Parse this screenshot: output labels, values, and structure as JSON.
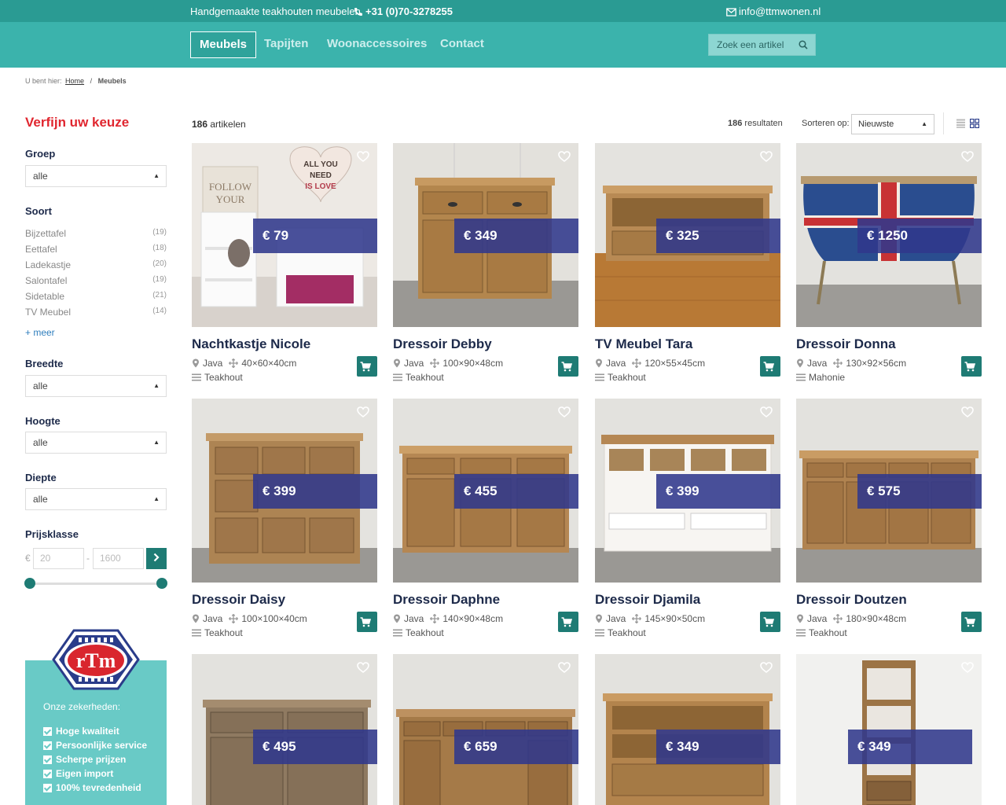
{
  "topbar": {
    "tagline": "Handgemaakte teakhouten meubelen",
    "phone": "+31 (0)70-3278255",
    "email": "info@ttmwonen.nl"
  },
  "nav": {
    "items": [
      "Meubels",
      "Tapijten",
      "Woonaccessoires",
      "Contact"
    ],
    "active": "Meubels",
    "search_placeholder": "Zoek een artikel"
  },
  "breadcrumb": {
    "prefix": "U bent hier:",
    "home": "Home",
    "current": "Meubels"
  },
  "sidebar": {
    "title": "Verfijn uw keuze",
    "groep": {
      "label": "Groep",
      "value": "alle"
    },
    "soort": {
      "label": "Soort",
      "items": [
        {
          "name": "Bijzettafel",
          "count": "(19)"
        },
        {
          "name": "Eettafel",
          "count": "(18)"
        },
        {
          "name": "Ladekastje",
          "count": "(20)"
        },
        {
          "name": "Salontafel",
          "count": "(19)"
        },
        {
          "name": "Sidetable",
          "count": "(21)"
        },
        {
          "name": "TV Meubel",
          "count": "(14)"
        }
      ],
      "more": "+ meer"
    },
    "breedte": {
      "label": "Breedte",
      "value": "alle"
    },
    "hoogte": {
      "label": "Hoogte",
      "value": "alle"
    },
    "diepte": {
      "label": "Diepte",
      "value": "alle"
    },
    "prijsklasse": {
      "label": "Prijsklasse",
      "currency": "€",
      "min_placeholder": "20",
      "max_placeholder": "1600",
      "separator": "-"
    },
    "guarantees": {
      "title": "Onze zekerheden:",
      "items": [
        "Hoge kwaliteit",
        "Persoonlijke service",
        "Scherpe prijzen",
        "Eigen import",
        "100% tevredenheid"
      ]
    }
  },
  "results": {
    "articles_number": "186",
    "articles_label": "artikelen",
    "results_number": "186",
    "results_label": "resultaten",
    "sort_label": "Sorteren op:",
    "sort_value": "Nieuwste"
  },
  "products": [
    {
      "title": "Nachtkastje Nicole",
      "price": "€ 79",
      "origin": "Java",
      "size": "40×60×40cm",
      "material": "Teakhout"
    },
    {
      "title": "Dressoir Debby",
      "price": "€ 349",
      "origin": "Java",
      "size": "100×90×48cm",
      "material": "Teakhout"
    },
    {
      "title": "TV Meubel Tara",
      "price": "€ 325",
      "origin": "Java",
      "size": "120×55×45cm",
      "material": "Teakhout"
    },
    {
      "title": "Dressoir Donna",
      "price": "€ 1250",
      "origin": "Java",
      "size": "130×92×56cm",
      "material": "Mahonie"
    },
    {
      "title": "Dressoir Daisy",
      "price": "€ 399",
      "origin": "Java",
      "size": "100×100×40cm",
      "material": "Teakhout"
    },
    {
      "title": "Dressoir Daphne",
      "price": "€ 455",
      "origin": "Java",
      "size": "140×90×48cm",
      "material": "Teakhout"
    },
    {
      "title": "Dressoir Djamila",
      "price": "€ 399",
      "origin": "Java",
      "size": "145×90×50cm",
      "material": "Teakhout"
    },
    {
      "title": "Dressoir Doutzen",
      "price": "€ 575",
      "origin": "Java",
      "size": "180×90×48cm",
      "material": "Teakhout"
    },
    {
      "price": "€ 495"
    },
    {
      "price": "€ 659"
    },
    {
      "price": "€ 349"
    },
    {
      "price": "€ 349"
    }
  ],
  "colors": {
    "topbar": "#2a9b93",
    "nav": "#3bb3ac",
    "accent": "#1e7b74",
    "title_red": "#e0262f",
    "price_overlay": "#30388c",
    "heading": "#1d2a4a"
  },
  "icons": [
    "phone-icon",
    "mail-icon",
    "search-icon",
    "heart-icon",
    "location-icon",
    "dimensions-icon",
    "material-icon",
    "cart-icon",
    "chevron-right-icon",
    "list-view-icon",
    "grid-view-icon",
    "check-icon"
  ]
}
